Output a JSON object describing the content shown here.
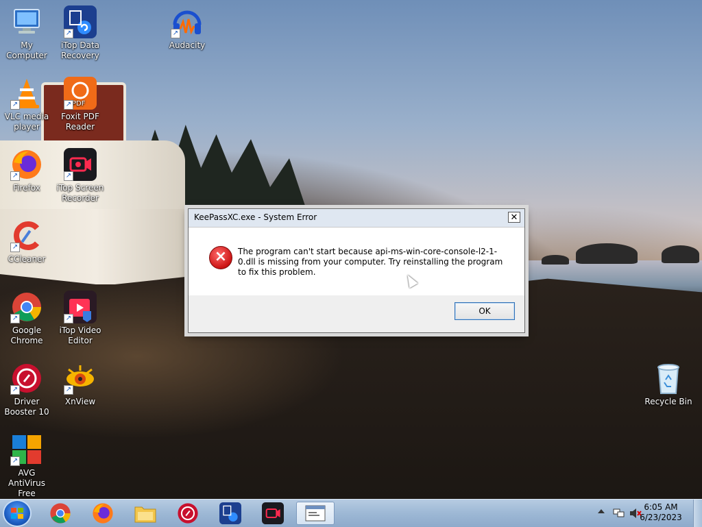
{
  "desktop_icons": [
    {
      "label": "My Computer",
      "icon": "computer-icon"
    },
    {
      "label": "iTop Data Recovery",
      "icon": "itop-data-recovery-icon"
    },
    {
      "label": "Audacity",
      "icon": "audacity-icon"
    },
    {
      "label": "VLC media player",
      "icon": "vlc-icon"
    },
    {
      "label": "Foxit PDF Reader",
      "icon": "foxit-pdf-icon"
    },
    {
      "label": "Firefox",
      "icon": "firefox-icon"
    },
    {
      "label": "iTop Screen Recorder",
      "icon": "itop-screen-recorder-icon"
    },
    {
      "label": "CCleaner",
      "icon": "ccleaner-icon"
    },
    {
      "label": "Google Chrome",
      "icon": "chrome-icon"
    },
    {
      "label": "iTop Video Editor",
      "icon": "itop-video-editor-icon"
    },
    {
      "label": "Driver Booster 10",
      "icon": "driver-booster-icon"
    },
    {
      "label": "XnView",
      "icon": "xnview-icon"
    },
    {
      "label": "AVG AntiVirus Free",
      "icon": "avg-antivirus-icon"
    },
    {
      "label": "Recycle Bin",
      "icon": "recycle-bin-icon"
    }
  ],
  "dialog": {
    "title": "KeePassXC.exe - System Error",
    "close_glyph": "✕",
    "message": "The program can't start because api-ms-win-core-console-l2-1-0.dll is missing from your computer. Try reinstalling the program to fix this problem.",
    "icon": "error-icon",
    "ok_label": "OK"
  },
  "taskbar": {
    "start_icon": "windows-start-icon",
    "pinned": [
      "chrome-icon",
      "firefox-icon",
      "file-explorer-icon",
      "driver-booster-icon",
      "itop-data-recovery-icon",
      "itop-screen-recorder-icon",
      "system-error-window-icon"
    ],
    "clock_time": "6:05 AM",
    "clock_date": "6/23/2023"
  },
  "colors": {
    "accent": "#2f6fb5",
    "error_red": "#cc1515",
    "taskbar": "#9db8d5"
  }
}
